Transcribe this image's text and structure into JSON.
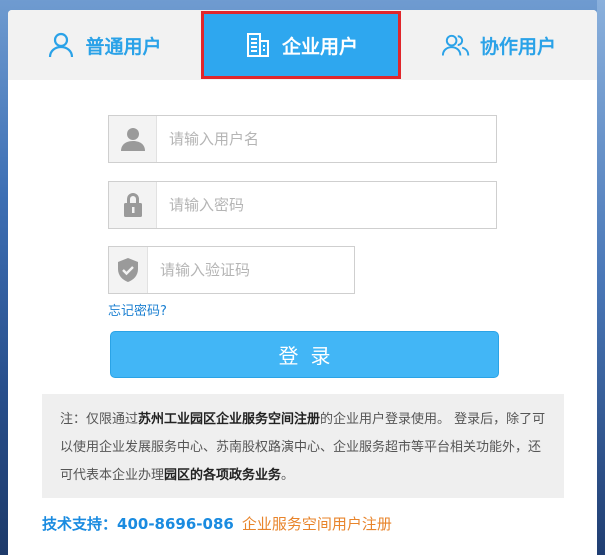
{
  "tabs": {
    "personal": "普通用户",
    "enterprise": "企业用户",
    "partner": "协作用户"
  },
  "form": {
    "username_placeholder": "请输入用户名",
    "password_placeholder": "请输入密码",
    "captcha_placeholder": "请输入验证码",
    "forgot_label": "忘记密码?",
    "login_label": "登录"
  },
  "note": {
    "prefix": "注：仅限通过",
    "bold1": "苏州工业园区企业服务空间注册",
    "middle": "的企业用户登录使用。 登录后，除了可以使用企业发展服务中心、苏南股权路演中心、企业服务超市等平台相关功能外，还可代表本企业办理",
    "bold2": "园区的各项政务业务",
    "suffix": "。"
  },
  "support": {
    "label": "技术支持：",
    "phone": "400-8696-086",
    "register_link": "企业服务空间用户注册"
  },
  "colors": {
    "accent": "#2ea7ef",
    "active_border": "#e0262b",
    "link": "#1a7fd1",
    "register": "#e8842b"
  }
}
